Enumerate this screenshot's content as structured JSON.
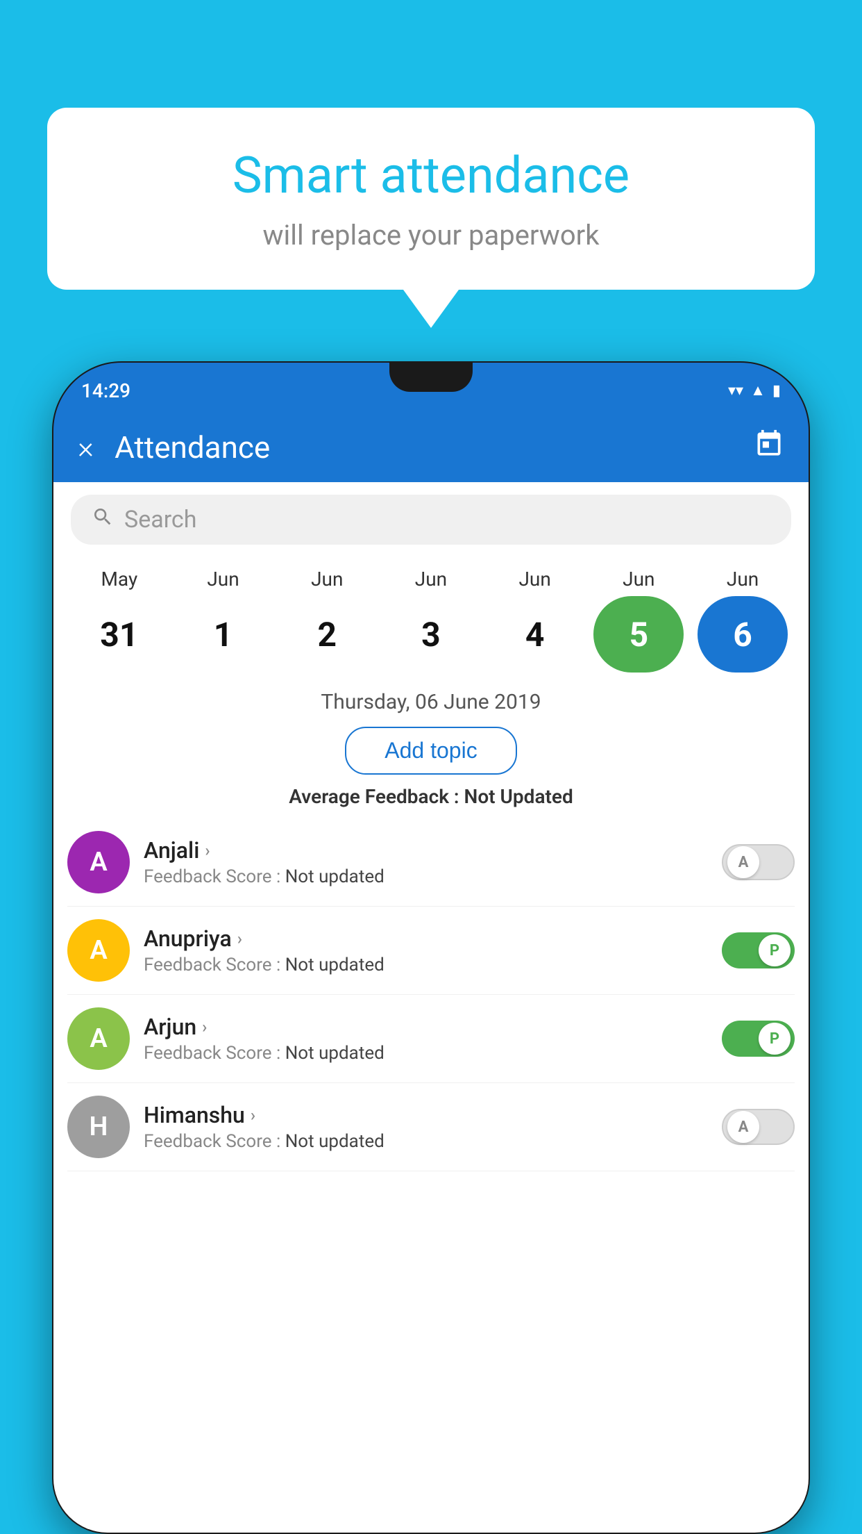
{
  "background_color": "#1BBDE8",
  "bubble": {
    "title": "Smart attendance",
    "subtitle": "will replace your paperwork"
  },
  "status_bar": {
    "time": "14:29",
    "icons": [
      "wifi",
      "signal",
      "battery"
    ]
  },
  "app_bar": {
    "close_label": "×",
    "title": "Attendance",
    "calendar_icon": "📅"
  },
  "search": {
    "placeholder": "Search"
  },
  "calendar": {
    "months": [
      "May",
      "Jun",
      "Jun",
      "Jun",
      "Jun",
      "Jun",
      "Jun"
    ],
    "days": [
      "31",
      "1",
      "2",
      "3",
      "4",
      "5",
      "6"
    ],
    "states": [
      "normal",
      "normal",
      "normal",
      "normal",
      "normal",
      "today",
      "selected"
    ]
  },
  "selected_date": "Thursday, 06 June 2019",
  "add_topic_label": "Add topic",
  "average_feedback_label": "Average Feedback :",
  "average_feedback_value": "Not Updated",
  "students": [
    {
      "name": "Anjali",
      "avatar_letter": "A",
      "avatar_color": "#9C27B0",
      "feedback_label": "Feedback Score :",
      "feedback_value": "Not updated",
      "toggle": "off",
      "toggle_letter": "A"
    },
    {
      "name": "Anupriya",
      "avatar_letter": "A",
      "avatar_color": "#FFC107",
      "feedback_label": "Feedback Score :",
      "feedback_value": "Not updated",
      "toggle": "on",
      "toggle_letter": "P"
    },
    {
      "name": "Arjun",
      "avatar_letter": "A",
      "avatar_color": "#8BC34A",
      "feedback_label": "Feedback Score :",
      "feedback_value": "Not updated",
      "toggle": "on",
      "toggle_letter": "P"
    },
    {
      "name": "Himanshu",
      "avatar_letter": "H",
      "avatar_color": "#9E9E9E",
      "feedback_label": "Feedback Score :",
      "feedback_value": "Not updated",
      "toggle": "off",
      "toggle_letter": "A"
    }
  ]
}
